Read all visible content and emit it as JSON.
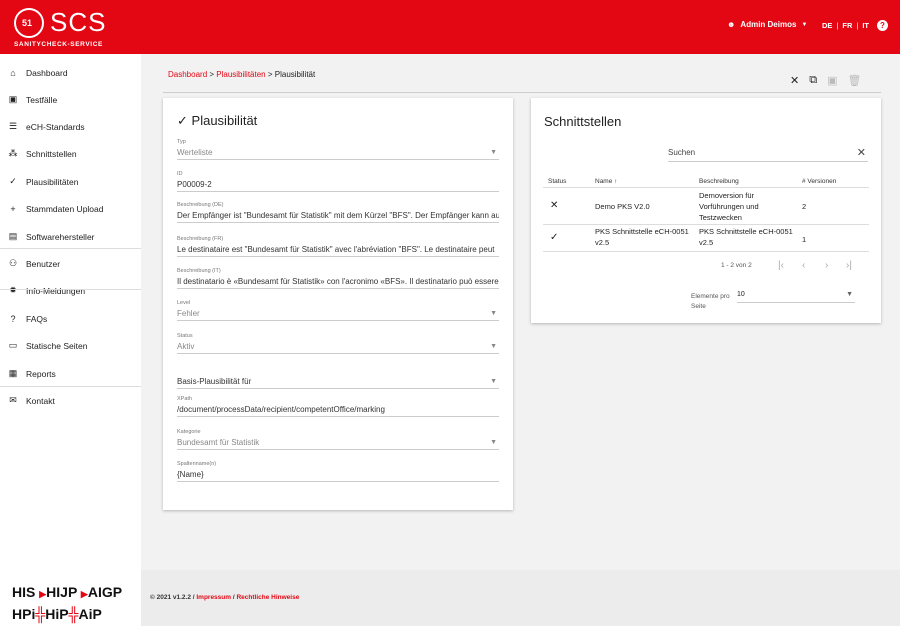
{
  "header": {
    "logo_main": "SCS",
    "logo_badge": "51",
    "logo_sub": "SANITYCHECK-SERVICE",
    "user": "Admin Deimos",
    "languages": [
      "DE",
      "FR",
      "IT"
    ],
    "help": "?"
  },
  "sidebar": {
    "items": [
      {
        "label": "Dashboard",
        "icon": "home-icon",
        "glyph": "⌂"
      },
      {
        "label": "Testfälle",
        "icon": "testcase-icon",
        "glyph": "▣"
      },
      {
        "label": "eCH-Standards",
        "icon": "list-icon",
        "glyph": "☰"
      },
      {
        "label": "Schnittstellen",
        "icon": "interface-icon",
        "glyph": "⁂"
      },
      {
        "label": "Plausibilitäten",
        "icon": "check-icon",
        "glyph": "✓"
      },
      {
        "label": "Stammdaten Upload",
        "icon": "plus-icon",
        "glyph": "+"
      },
      {
        "label": "Softwarehersteller",
        "icon": "building-icon",
        "glyph": "▤"
      },
      {
        "label": "Benutzer",
        "icon": "users-icon",
        "glyph": "⚇"
      },
      {
        "label": "Info-Meldungen",
        "icon": "info-icon",
        "glyph": "✹"
      },
      {
        "label": "FAQs",
        "icon": "help-icon",
        "glyph": "?"
      },
      {
        "label": "Statische Seiten",
        "icon": "page-icon",
        "glyph": "▭"
      },
      {
        "label": "Reports",
        "icon": "report-icon",
        "glyph": "▦"
      },
      {
        "label": "Kontakt",
        "icon": "mail-icon",
        "glyph": "✉"
      }
    ],
    "footer_logos": {
      "line1": [
        "HIS",
        "HIJP",
        "AIGP"
      ],
      "line2": [
        "HPi",
        "HiP",
        "AiP"
      ]
    }
  },
  "breadcrumb": {
    "items": [
      "Dashboard",
      "Plausibilitäten"
    ],
    "separator": " > ",
    "current": "Plausibilität"
  },
  "detail": {
    "title": "Plausibilität",
    "fields": [
      {
        "label": "Typ",
        "value": "Werteliste",
        "dropdown": true,
        "dim": true
      },
      {
        "label": "ID",
        "value": "P00009-2",
        "dropdown": false,
        "dim": false
      },
      {
        "label": "Beschreibung (DE)",
        "value": "Der Empfänger ist \"Bundesamt für Statistik\" mit dem Kürzel \"BFS\". Der Empfänger kann auch",
        "dropdown": false,
        "dim": false
      },
      {
        "label": "Beschreibung (FR)",
        "value": "Le destinataire est \"Bundesamt für Statistik\" avec l'abréviation \"BFS\". Le destinataire peut",
        "dropdown": false,
        "dim": false
      },
      {
        "label": "Beschreibung (IT)",
        "value": "Il destinatario è «Bundesamt für Statistik» con l'acronimo «BFS». Il destinatario può essere",
        "dropdown": false,
        "dim": false
      },
      {
        "label": "Level",
        "value": "Fehler",
        "dropdown": true,
        "dim": true
      },
      {
        "label": "Status",
        "value": "Aktiv",
        "dropdown": true,
        "dim": true
      },
      {
        "label": "",
        "value": "Basis-Plausibilität für",
        "dropdown": true,
        "dim": false
      },
      {
        "label": "XPath",
        "value": "/document/processData/recipient/competentOffice/marking",
        "dropdown": false,
        "dim": false
      },
      {
        "label": "Kategorie",
        "value": "Bundesamt für Statistik",
        "dropdown": true,
        "dim": true
      },
      {
        "label": "Spaltenname(n)",
        "value": "{Name}",
        "dropdown": false,
        "dim": false
      }
    ]
  },
  "interfaces": {
    "title": "Schnittstellen",
    "search_placeholder": "Suchen",
    "columns": [
      "Status",
      "Name",
      "Beschreibung",
      "# Versionen"
    ],
    "sort_glyph": "↑",
    "rows": [
      {
        "status": "✕",
        "status_icon": "cross-icon",
        "name": "Demo PKS V2.0",
        "description": "Demoversion für Vorführungen und Testzwecken",
        "versions": "2"
      },
      {
        "status": "✓",
        "status_icon": "check-icon",
        "name": "PKS Schnittstelle eCH-0051 v2.5",
        "description": "PKS Schnittstelle eCH-0051 v2.5",
        "versions": "1"
      }
    ],
    "pagination": "1 - 2 von 2",
    "per_page_label": "Elemente pro Seite",
    "per_page_value": "10"
  },
  "footer": {
    "copyright": "© 2021 v1.2.2 / ",
    "impressum": "Impressum",
    "sep": " / ",
    "legal": "Rechtliche Hinweise"
  },
  "colors": {
    "accent": "#e30613"
  }
}
